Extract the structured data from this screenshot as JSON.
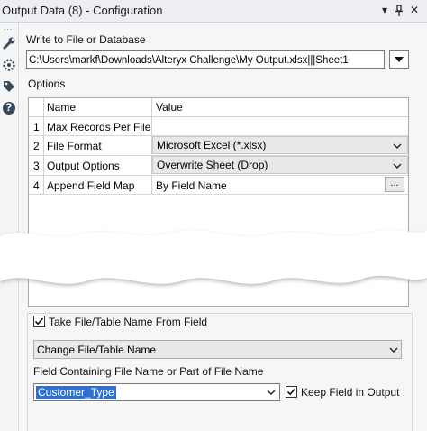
{
  "window": {
    "title": "Output Data (8) - Configuration",
    "controls": {
      "dropdown": "▾",
      "pin": "ᵖ",
      "close": "✕"
    }
  },
  "toolstrip": {
    "dots": "....",
    "icons": [
      "wrench-icon",
      "gear-icon",
      "tag-icon",
      "help-icon"
    ],
    "help_glyph": "?"
  },
  "config": {
    "write_label": "Write to File or Database",
    "path_value": "C:\\Users\\markf\\Downloads\\Alteryx Challenge\\My Output.xlsx|||Sheet1",
    "options_label": "Options",
    "grid": {
      "headers": {
        "name": "Name",
        "value": "Value"
      },
      "rows": [
        {
          "num": "1",
          "name": "Max Records Per File",
          "value": ""
        },
        {
          "num": "2",
          "name": "File Format",
          "value": "Microsoft Excel (*.xlsx)"
        },
        {
          "num": "3",
          "name": "Output Options",
          "value": "Overwrite Sheet (Drop)"
        },
        {
          "num": "4",
          "name": "Append Field Map",
          "value": "By Field Name",
          "button": "..."
        }
      ]
    },
    "take_from_field_label": "Take File/Table Name From Field",
    "take_from_field_checked": true,
    "mode_select_value": "Change File/Table Name",
    "field_label": "Field Containing File Name or Part of File Name",
    "field_value": "Customer_Type",
    "keep_field_label": "Keep Field in Output",
    "keep_field_checked": true
  },
  "colors": {
    "titlebar": "#eceef2",
    "panel": "#f6f6f6",
    "selection": "#2f6fd0"
  }
}
